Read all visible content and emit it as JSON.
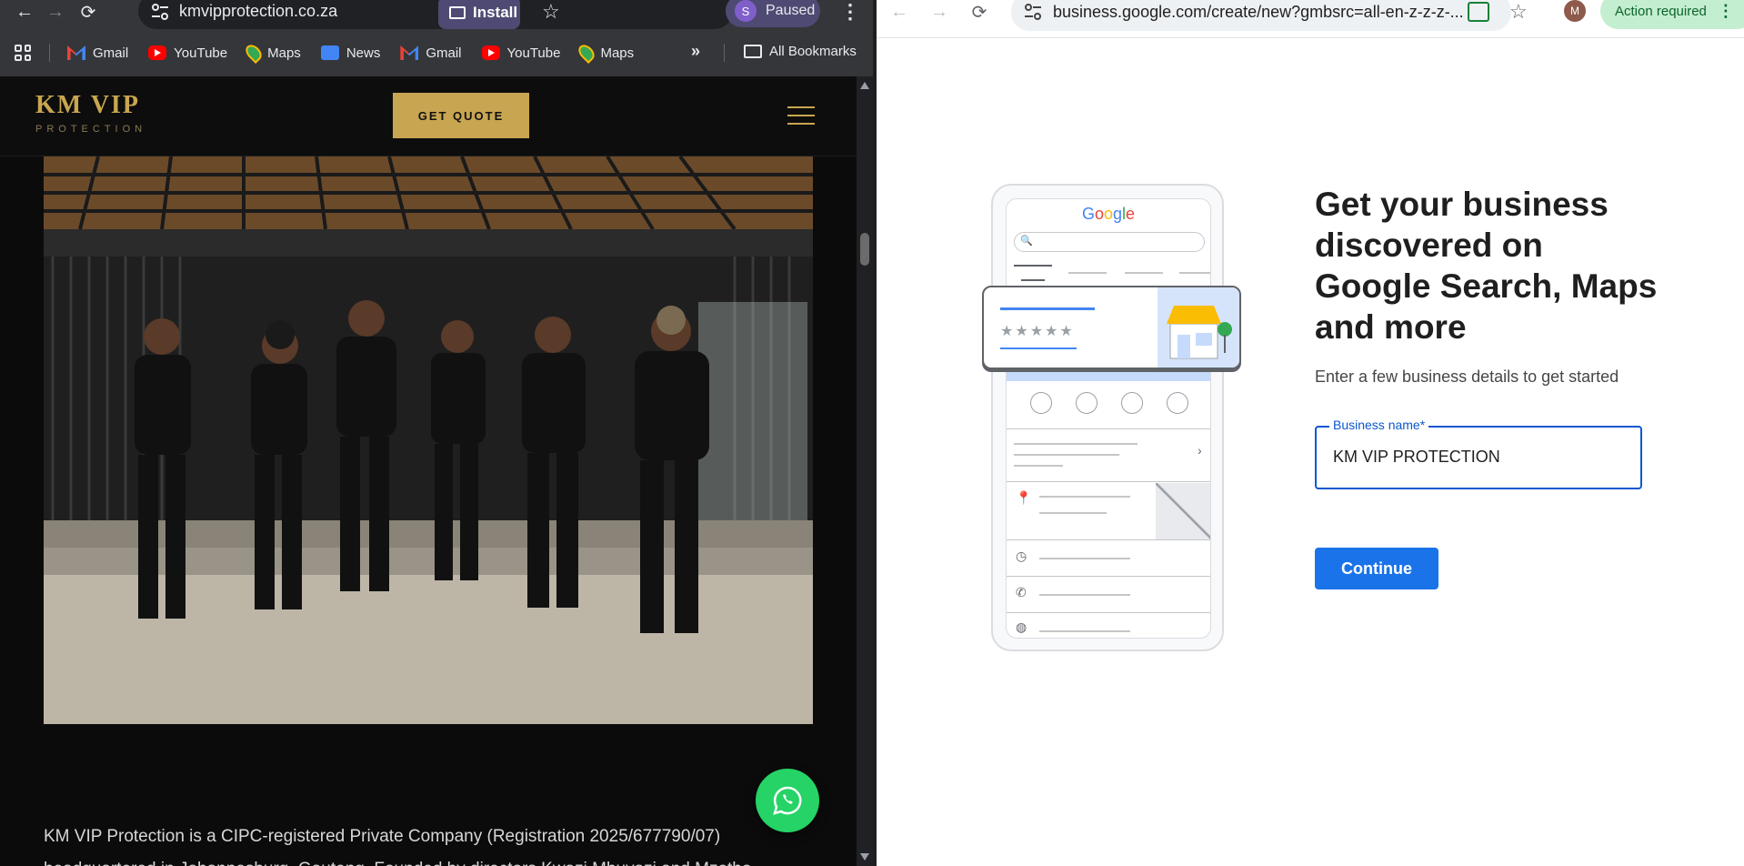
{
  "left_window": {
    "url": "kmvipprotection.co.za",
    "install_label": "Install",
    "profile_initial": "S",
    "profile_status": "Paused",
    "bookmarks": [
      {
        "label": "Gmail",
        "icon": "gmail-icon"
      },
      {
        "label": "YouTube",
        "icon": "youtube-icon"
      },
      {
        "label": "Maps",
        "icon": "maps-icon"
      },
      {
        "label": "News",
        "icon": "news-icon"
      },
      {
        "label": "Gmail",
        "icon": "gmail-icon"
      },
      {
        "label": "YouTube",
        "icon": "youtube-icon"
      },
      {
        "label": "Maps",
        "icon": "maps-icon"
      }
    ],
    "all_bookmarks_label": "All Bookmarks",
    "site": {
      "logo_main": "KM VIP",
      "logo_sub": "PROTECTION",
      "quote_button": "GET QUOTE",
      "paragraph": "KM VIP Protection is a CIPC-registered Private Company (Registration 2025/677790/07) headquartered in Johannesburg, Gauteng. Founded by directors Kwazi Mbuyazi and Mzotho",
      "colors": {
        "gold": "#c8a551",
        "background": "#0b0b0b",
        "whatsapp": "#25d366"
      }
    }
  },
  "right_window": {
    "url": "business.google.com/create/new?gmbsrc=all-en-z-z-z-...",
    "avatar_initial": "M",
    "action_required_label": "Action required",
    "google_logo": "Google",
    "headline": "Get your business discovered on Google Search, Maps and more",
    "subheading": "Enter a few business details to get started",
    "field_label": "Business name*",
    "field_value": "KM VIP PROTECTION",
    "continue_label": "Continue",
    "colors": {
      "primary": "#1a73e8",
      "field_border": "#0b57d0",
      "action_bg": "#c4eed0"
    }
  }
}
